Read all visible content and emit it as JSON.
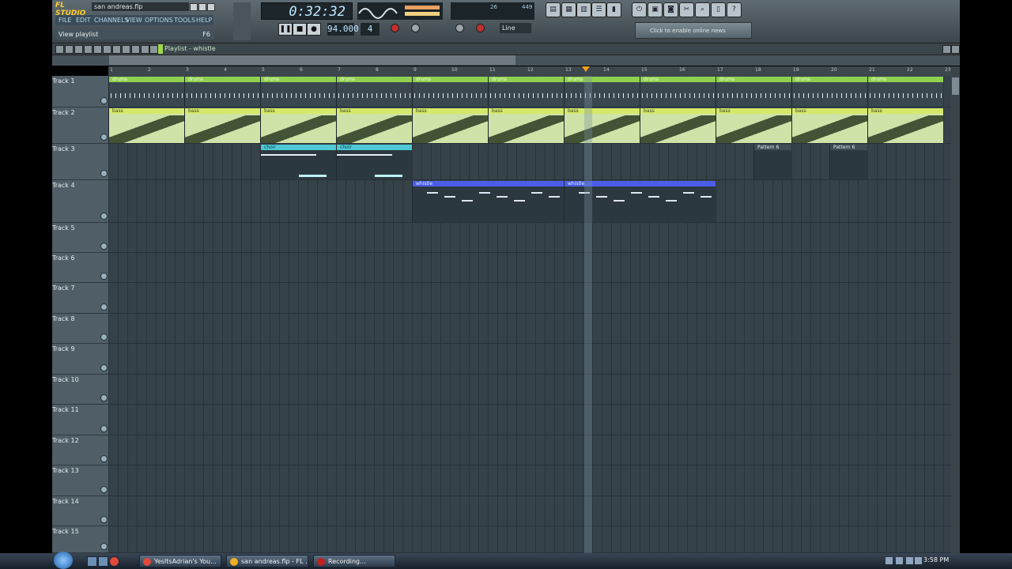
{
  "app": {
    "logo": "FL STUDIO",
    "filename": "san andreas.flp",
    "menu": [
      "FILE",
      "EDIT",
      "CHANNELS",
      "VIEW",
      "OPTIONS",
      "TOOLS",
      "HELP"
    ],
    "hint": "View playlist",
    "hint_key": "F6"
  },
  "transport": {
    "time": "0:32:32",
    "bpm": "94.000",
    "snap_value": "4",
    "snap_mode": "Line",
    "cpu_value": "26",
    "mem_value": "449",
    "news_text": "Click to enable online news",
    "play_icon": "pause-icon",
    "stop_icon": "stop-icon",
    "record_icon": "record-icon"
  },
  "playlist": {
    "title": "Playlist - whistle",
    "bar_numbers": [
      "1",
      "2",
      "3",
      "4",
      "5",
      "6",
      "7",
      "8",
      "9",
      "10",
      "11",
      "12",
      "13",
      "14",
      "15",
      "16",
      "17",
      "18",
      "19",
      "20",
      "21",
      "22",
      "23"
    ],
    "tracks": [
      {
        "name": "Track 1",
        "height": 40
      },
      {
        "name": "Track 2",
        "height": 46
      },
      {
        "name": "Track 3",
        "height": 46
      },
      {
        "name": "Track 4",
        "height": 54
      },
      {
        "name": "Track 5",
        "height": 38
      },
      {
        "name": "Track 6",
        "height": 38
      },
      {
        "name": "Track 7",
        "height": 39
      },
      {
        "name": "Track 8",
        "height": 38
      },
      {
        "name": "Track 9",
        "height": 39
      },
      {
        "name": "Track 10",
        "height": 38
      },
      {
        "name": "Track 11",
        "height": 39
      },
      {
        "name": "Track 12",
        "height": 38
      },
      {
        "name": "Track 13",
        "height": 39
      },
      {
        "name": "Track 14",
        "height": 38
      },
      {
        "name": "Track 15",
        "height": 34
      }
    ],
    "clips": {
      "track1_label": "drums",
      "track2_label": "bass",
      "track3_label": "choir",
      "track3_pattern": "Pattern 6",
      "track4_label": "whistle"
    },
    "colors": {
      "track1": "#8fd14f",
      "track2": "#d6e86a",
      "track3": "#4fc9d6",
      "track4": "#4a5ee8",
      "pattern6": "#3f4c54"
    }
  },
  "taskbar": {
    "tasks": [
      {
        "label": "YesItsAdrian's You...",
        "icon_color": "#e04a3a",
        "icon": "chrome-icon"
      },
      {
        "label": "san andreas.flp - FL ...",
        "icon_color": "#f0b020",
        "icon": "fl-studio-icon"
      },
      {
        "label": "Recording...",
        "icon_color": "#c02020",
        "icon": "recorder-icon"
      }
    ],
    "clock": "3:58 PM"
  }
}
